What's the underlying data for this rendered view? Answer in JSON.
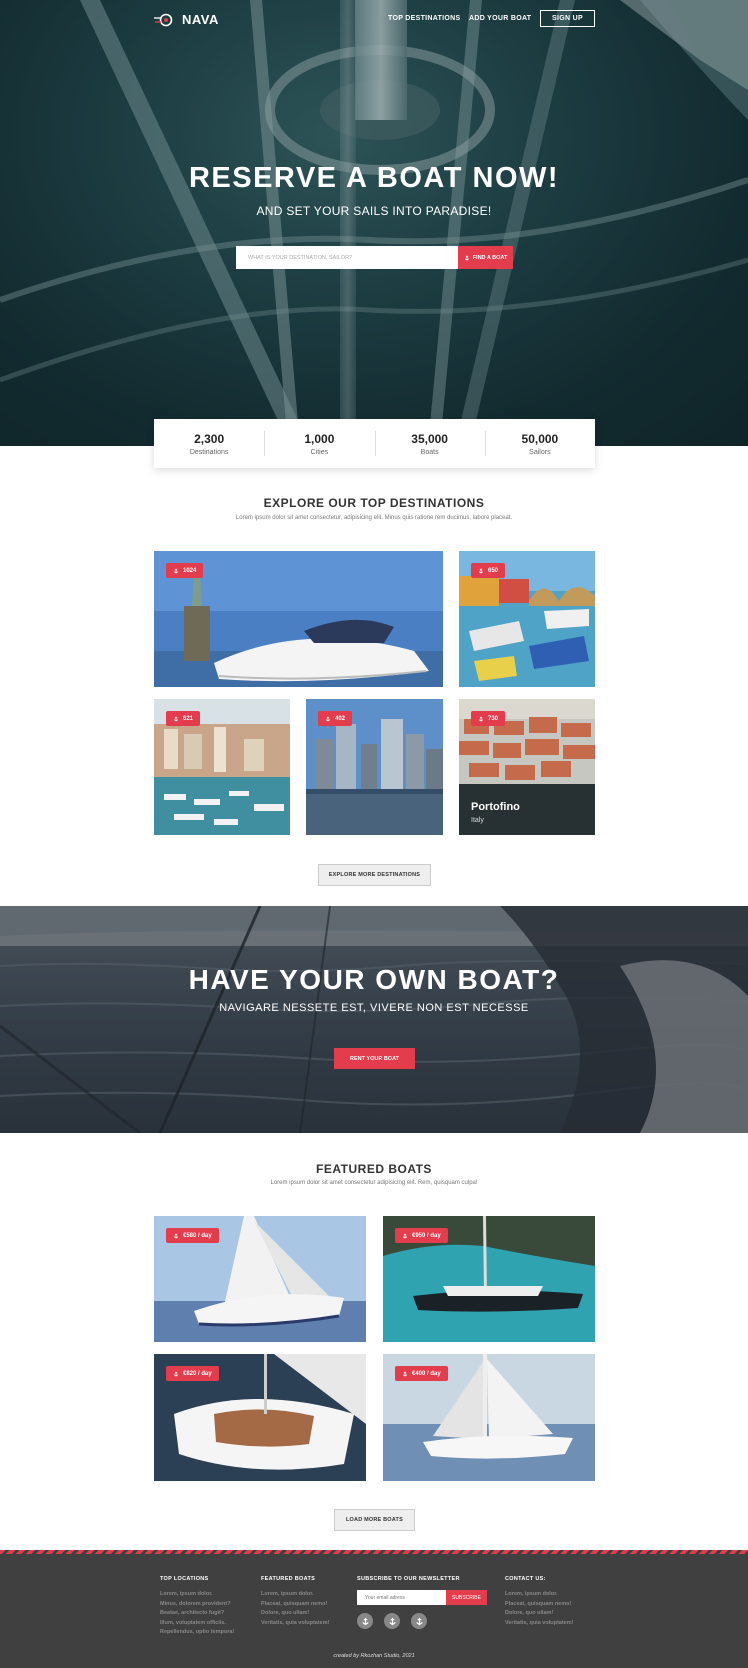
{
  "header": {
    "logo_text": "NAVA",
    "nav": [
      "TOP DESTINATIONS",
      "ADD YOUR BOAT"
    ],
    "signup": "SIGN UP"
  },
  "hero": {
    "title": "RESERVE A BOAT NOW!",
    "subtitle": "AND SET YOUR SAILS INTO PARADISE!",
    "search_placeholder": "WHAT IS YOUR DESTINATION, SAILOR?",
    "search_button": "FIND A BOAT"
  },
  "stats": [
    {
      "value": "2,300",
      "label": "Destinations"
    },
    {
      "value": "1,000",
      "label": "Cities"
    },
    {
      "value": "35,000",
      "label": "Boats"
    },
    {
      "value": "50,000",
      "label": "Sailors"
    }
  ],
  "destinations": {
    "title": "EXPLORE OUR TOP DESTINATIONS",
    "subtitle": "Lorem ipsum dolor sit amet consectetur, adipisicing elit. Minus quis ratione rem ducimus, labore placeat.",
    "tiles": [
      {
        "count": "1024"
      },
      {
        "count": "650"
      },
      {
        "count": "621"
      },
      {
        "count": "402"
      },
      {
        "count": "730",
        "city": "Portofino",
        "country": "Italy"
      }
    ],
    "more_button": "EXPLORE MORE DESTINATIONS"
  },
  "own_boat": {
    "title": "HAVE YOUR OWN BOAT?",
    "subtitle": "NAVIGARE NESSETE EST, VIVERE NON EST NECESSE",
    "button": "RENT YOUR BOAT"
  },
  "featured": {
    "title": "FEATURED BOATS",
    "subtitle": "Lorem ipsum dolor sit amet consectetur adipisicing elit. Rem, quisquam culpa!",
    "boats": [
      {
        "price": "€580 / day"
      },
      {
        "price": "€950 / day"
      },
      {
        "price": "€820 / day"
      },
      {
        "price": "€400 / day"
      }
    ],
    "more_button": "LOAD MORE BOATS"
  },
  "footer": {
    "top_locations": {
      "heading": "TOP LOCATIONS",
      "lines": [
        "Lorem, ipsum dolor.",
        "Minus, dolorem provident?",
        "Beatae, architecto fugit?",
        "Illum, voluptatem officiis.",
        "Repellendus, optio tempora!"
      ]
    },
    "featured_boats": {
      "heading": "FEATURED BOATS",
      "lines": [
        "Lorem, ipsum dolor.",
        "Placeat, quisquam nemo!",
        "Dolore, quo ullam!",
        "Veritatis, quia voluptatem!"
      ]
    },
    "newsletter": {
      "heading": "SUBSCRIBE TO OUR NEWSLETTER",
      "placeholder": "Your email adress",
      "button": "SUBSCRIBE"
    },
    "contact": {
      "heading": "CONTACT US:",
      "lines": [
        "Lorem, ipsum dolor.",
        "Placeat, quisquam nemo!",
        "Dolore, quo ullam!",
        "Veritatis, quia voluptatem!"
      ]
    },
    "credit": "created by Rkozhan Studio, 2021"
  },
  "colors": {
    "accent": "#e23c4d",
    "footer_bg": "#404040",
    "hero_overlay": "#1c3a3d"
  }
}
